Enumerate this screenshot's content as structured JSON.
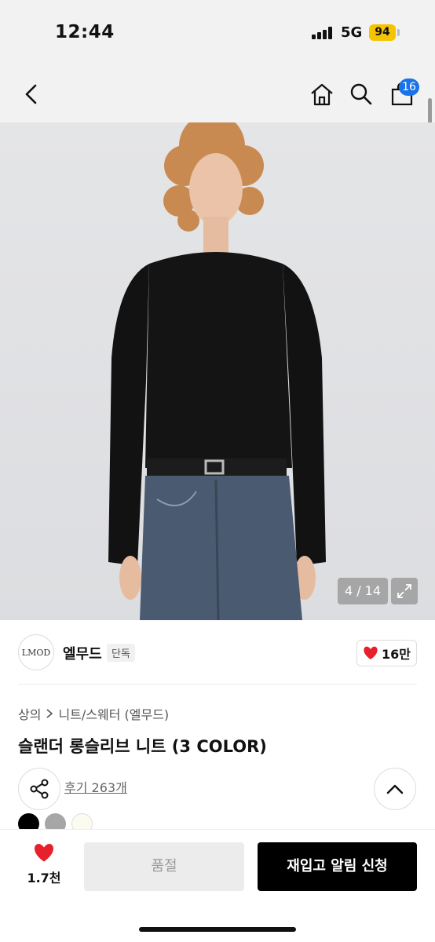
{
  "status_bar": {
    "time": "12:44",
    "network": "5G",
    "battery": "94"
  },
  "nav": {
    "cart_count": "16"
  },
  "image": {
    "counter": "4 / 14"
  },
  "brand": {
    "logo_text": "LMOD",
    "name": "엘무드",
    "tag": "단독",
    "likes": "16만"
  },
  "breadcrumb": {
    "category": "상의",
    "subcategory": "니트/스웨터 (엘무드)"
  },
  "product": {
    "title": "슬랜더 롱슬리브 니트 (3 COLOR)",
    "reviews": "후기 263개"
  },
  "swatches": [
    {
      "color": "#000000"
    },
    {
      "color": "#a6a6a6"
    },
    {
      "color": "#fbfbef"
    }
  ],
  "bottom_bar": {
    "wish_count": "1.7천",
    "soldout_label": "품절",
    "restock_label": "재입고 알림 신청"
  },
  "colors": {
    "accent": "#1a73e8",
    "heart": "#e8202b",
    "battery": "#f5c400"
  }
}
